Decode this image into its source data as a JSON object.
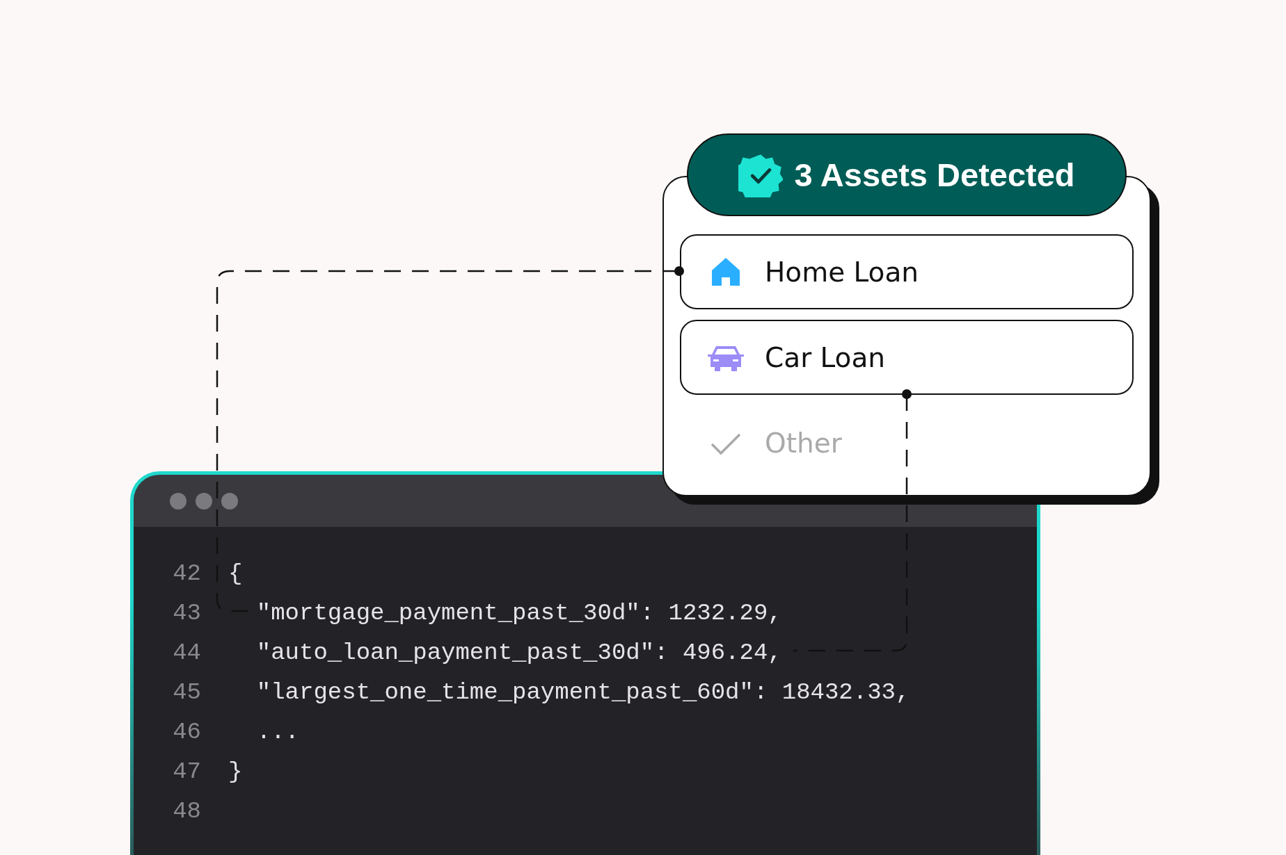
{
  "code_window": {
    "lines": [
      {
        "number": "42",
        "text": "{"
      },
      {
        "number": "43",
        "text": "  \"mortgage_payment_past_30d\": 1232.29,"
      },
      {
        "number": "44",
        "text": "  \"auto_loan_payment_past_30d\": 496.24,"
      },
      {
        "number": "45",
        "text": "  \"largest_one_time_payment_past_60d\": 18432.33,"
      },
      {
        "number": "46",
        "text": "  ..."
      },
      {
        "number": "47",
        "text": "}"
      },
      {
        "number": "48"
      }
    ]
  },
  "assets_card": {
    "title": "3 Assets Detected",
    "items": [
      {
        "kind": "home",
        "label": "Home Loan",
        "detected": true
      },
      {
        "kind": "car",
        "label": "Car Loan",
        "detected": true
      },
      {
        "kind": "check",
        "label": "Other",
        "detected": false
      }
    ]
  }
}
